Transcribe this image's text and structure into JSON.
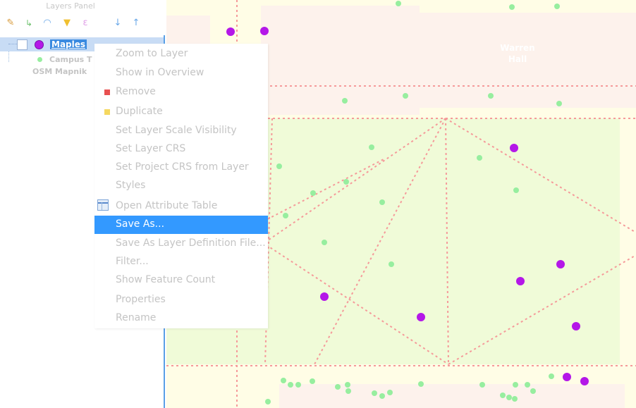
{
  "panel": {
    "title": "Layers Panel",
    "toolbar_icons": [
      "paint-brush-icon",
      "tree-add-icon",
      "group-icon",
      "filter-icon",
      "expression-icon",
      "sort-down-icon",
      "sort-up-icon"
    ]
  },
  "layers": {
    "selected": {
      "name": "Maples",
      "color": "#b417e8"
    },
    "sub_item": {
      "label": "Campus T"
    },
    "basemap": {
      "label": "OSM Mapnik"
    }
  },
  "map": {
    "label_line1": "Warren",
    "label_line2": "Hall",
    "colors": {
      "background": "#fffde6",
      "park": "#f0fbd8",
      "building": "#fdf2ec",
      "path": "#f59a9a",
      "point_green": "#97ee9f",
      "point_purple": "#b417e8"
    }
  },
  "context_menu": {
    "items": [
      {
        "label": "Zoom to Layer",
        "icon": ""
      },
      {
        "label": "Show in Overview",
        "icon": ""
      },
      {
        "label": "Remove",
        "icon": "remove-icon"
      },
      {
        "label": "Duplicate",
        "icon": "duplicate-icon"
      },
      {
        "label": "Set Layer Scale Visibility",
        "icon": ""
      },
      {
        "label": "Set Layer CRS",
        "icon": ""
      },
      {
        "label": "Set Project CRS from Layer",
        "icon": ""
      },
      {
        "label": "Styles",
        "icon": ""
      },
      {
        "label": "Open Attribute Table",
        "icon": "table-icon"
      },
      {
        "label": "Save As...",
        "icon": "",
        "selected": true
      },
      {
        "label": "Save As Layer Definition File...",
        "icon": ""
      },
      {
        "label": "Filter...",
        "icon": ""
      },
      {
        "label": "Show Feature Count",
        "icon": ""
      },
      {
        "label": "Properties",
        "icon": ""
      },
      {
        "label": "Rename",
        "icon": ""
      }
    ]
  }
}
